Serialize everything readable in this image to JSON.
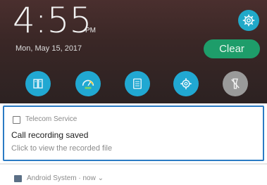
{
  "header": {
    "time": "4:55",
    "ampm": "PM",
    "date": "Mon, May 15, 2017",
    "clear_label": "Clear"
  },
  "quick_settings": [
    {
      "icon": "book-icon"
    },
    {
      "icon": "speed-gauge-icon"
    },
    {
      "icon": "notes-icon"
    },
    {
      "icon": "settings-gear-icon"
    },
    {
      "icon": "flashlight-off-icon"
    }
  ],
  "notifications": [
    {
      "app": "Telecom Service",
      "title": "Call recording saved",
      "text": "Click to view the recorded file"
    },
    {
      "app": "Android System · now ⌄"
    }
  ],
  "colors": {
    "accent": "#21a8d2",
    "clear_button": "#1e9d6a",
    "highlight_border": "#2b7bc4"
  }
}
